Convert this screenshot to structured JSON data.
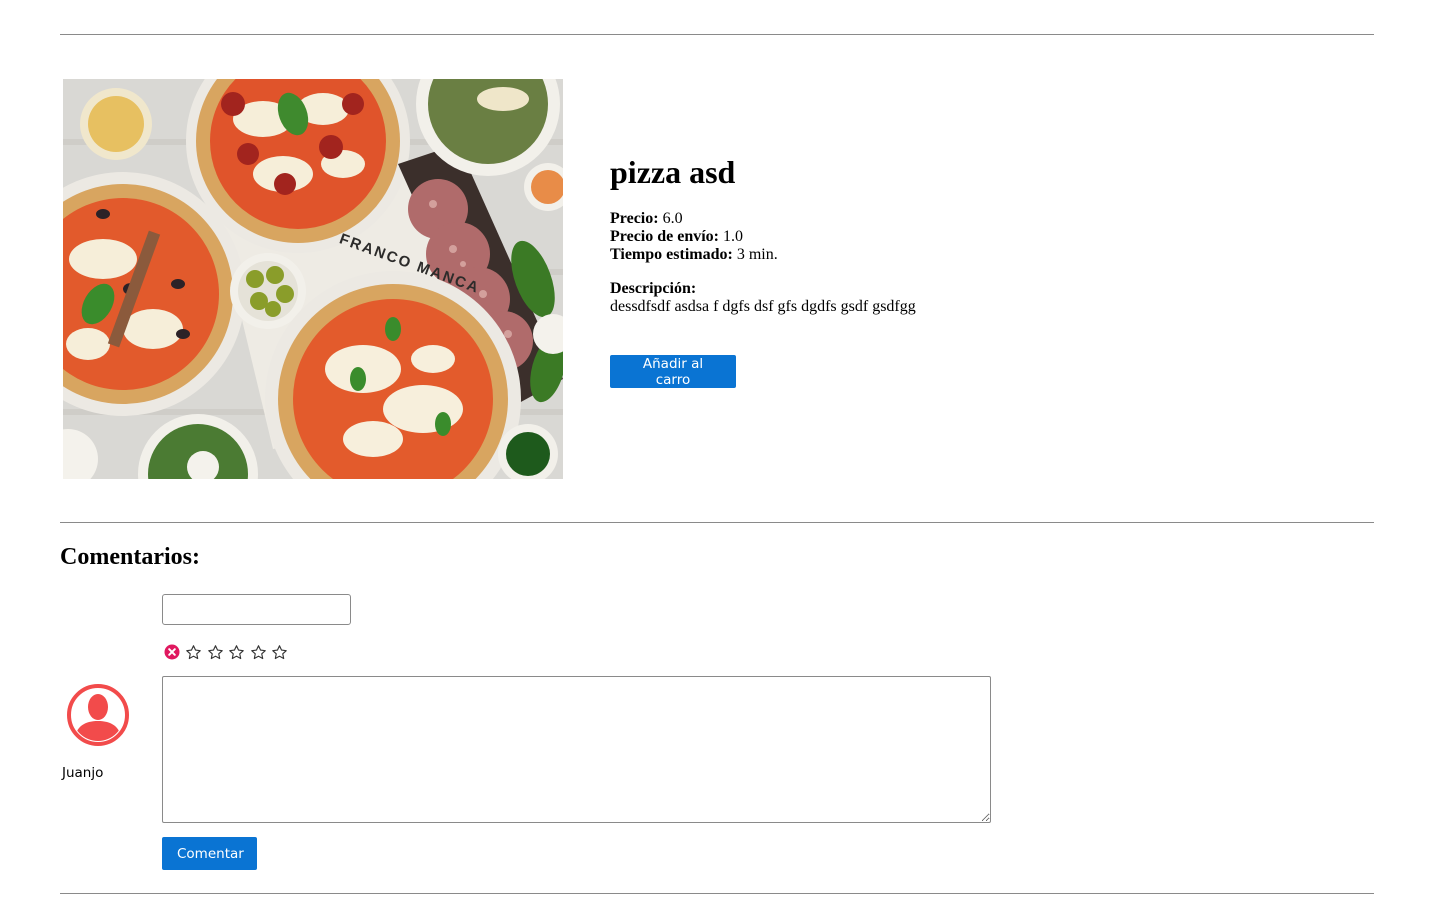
{
  "product": {
    "title": "pizza asd",
    "price_label": "Precio:",
    "price_value": "6.0",
    "shipping_label": "Precio de envío:",
    "shipping_value": "1.0",
    "time_label": "Tiempo estimado:",
    "time_value": "3 min.",
    "description_label": "Descripción:",
    "description_value": "dessdfsdf asdsa f dgfs dsf gfs dgdfs gsdf gsdfgg",
    "image_text": "FRANCO MANCA",
    "add_to_cart_label": "Añadir al carro"
  },
  "comments": {
    "section_title": "Comentarios:",
    "title_input_value": "",
    "title_input_placeholder": "",
    "rating_value": 0,
    "rating_max": 5,
    "user_name": "Juanjo",
    "comment_text_value": "",
    "comment_text_placeholder": "",
    "submit_label": "Comentar"
  },
  "colors": {
    "accent": "#0a74d3",
    "avatar": "#f24b4b",
    "clear_icon": "#e0185f"
  }
}
